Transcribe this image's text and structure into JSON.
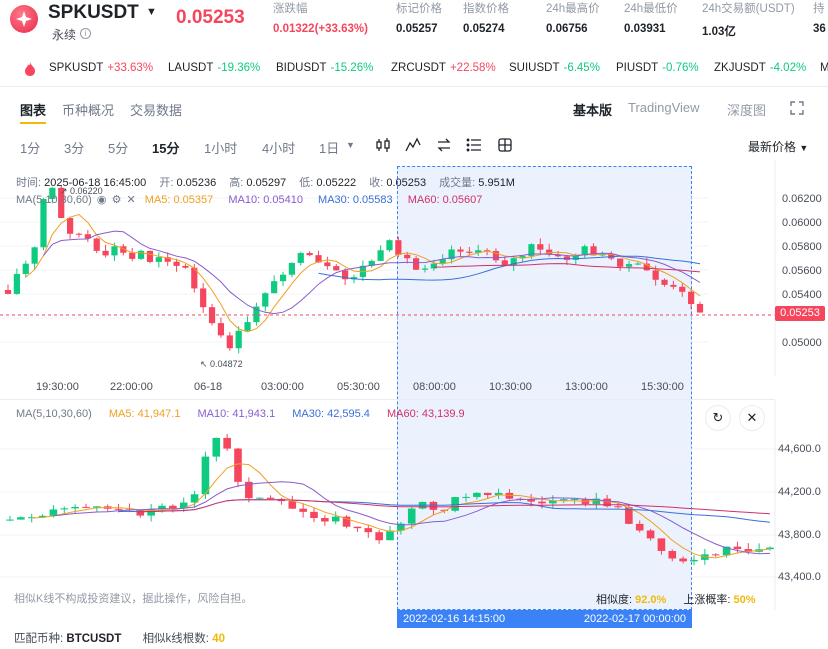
{
  "header": {
    "symbol": "SPKUSDT",
    "subtitle": "永续",
    "price": "0.05253",
    "stats": [
      {
        "label": "涨跌幅",
        "value": "0.01322(+33.63%)",
        "color": "#f6465d"
      },
      {
        "label": "标记价格",
        "value": "0.05257"
      },
      {
        "label": "指数价格",
        "value": "0.05274"
      },
      {
        "label": "24h最高价",
        "value": "0.06756"
      },
      {
        "label": "24h最低价",
        "value": "0.03931"
      },
      {
        "label": "24h交易额(USDT)",
        "value": "1.03亿"
      },
      {
        "label": "持",
        "value": "36"
      }
    ]
  },
  "ticker": [
    {
      "sym": "SPKUSDT",
      "chg": "+33.63%",
      "dir": "up"
    },
    {
      "sym": "LAUSDT",
      "chg": "-19.36%",
      "dir": "down"
    },
    {
      "sym": "BIDUSDT",
      "chg": "-15.26%",
      "dir": "down"
    },
    {
      "sym": "ZRCUSDT",
      "chg": "+22.58%",
      "dir": "up"
    },
    {
      "sym": "SUIUSDT",
      "chg": "-6.45%",
      "dir": "down"
    },
    {
      "sym": "PIUSDT",
      "chg": "-0.76%",
      "dir": "down"
    },
    {
      "sym": "ZKJUSDT",
      "chg": "-4.02%",
      "dir": "down"
    },
    {
      "sym": "M",
      "chg": "",
      "dir": "up"
    }
  ],
  "tabs": [
    "图表",
    "币种概况",
    "交易数据"
  ],
  "right_tabs": [
    "基本版",
    "TradingView",
    "深度图"
  ],
  "intervals": [
    "1分",
    "3分",
    "5分",
    "15分",
    "1小时",
    "4小时",
    "1日"
  ],
  "latest_label": "最新价格",
  "ohlc": {
    "time_label": "时间:",
    "time": "2025-06-18 16:45:00",
    "open_label": "开:",
    "open": "0.05236",
    "high_label": "高:",
    "high": "0.05297",
    "low_label": "低:",
    "low": "0.05222",
    "close_label": "收:",
    "close": "0.05253",
    "vol_label": "成交量:",
    "vol": "5.951M"
  },
  "main_ma": {
    "title": "MA(5,10,30,60)",
    "ma5": "MA5: 0.05357",
    "ma10": "MA10: 0.05410",
    "ma30": "MA30: 0.05583",
    "ma60": "MA60: 0.05607"
  },
  "main_chart": {
    "y_ticks": [
      "0.06200",
      "0.06000",
      "0.05800",
      "0.05600",
      "0.05400",
      "0.05000"
    ],
    "x_ticks": [
      "19:30:00",
      "22:00:00",
      "06-18",
      "03:00:00",
      "05:30:00",
      "08:00:00",
      "10:30:00",
      "13:00:00",
      "15:30:00"
    ],
    "current_price": "0.05253",
    "high_marker": "0.06220",
    "low_marker": "0.04872"
  },
  "sim_ma": {
    "title": "MA(5,10,30,60)",
    "ma5": "MA5: 41,947.1",
    "ma10": "MA10: 41,943.1",
    "ma30": "MA30: 42,595.4",
    "ma60": "MA60: 43,139.9"
  },
  "sim_chart": {
    "y_ticks": [
      "44,600.0",
      "44,200.0",
      "43,800.0",
      "43,400.0"
    ]
  },
  "disclaimer": "相似K线不构成投资建议，据此操作，风险自担。",
  "similarity": {
    "label": "相似度:",
    "value": "92.0%",
    "prob_label": "上涨概率:",
    "prob_value": "50%"
  },
  "date_band": {
    "start": "2022-02-16 14:15:00",
    "end": "2022-02-17 00:00:00"
  },
  "footer": {
    "coin_label": "匹配币种:",
    "coin": "BTCUSDT",
    "count_label": "相似k线根数:",
    "count": "40"
  },
  "colors": {
    "up": "#0ecb81",
    "down": "#f6465d",
    "ma5": "#f0a020",
    "ma10": "#8a5cd0",
    "ma30": "#3b6fd8",
    "ma60": "#d0306a",
    "accent": "#f0b90b"
  }
}
